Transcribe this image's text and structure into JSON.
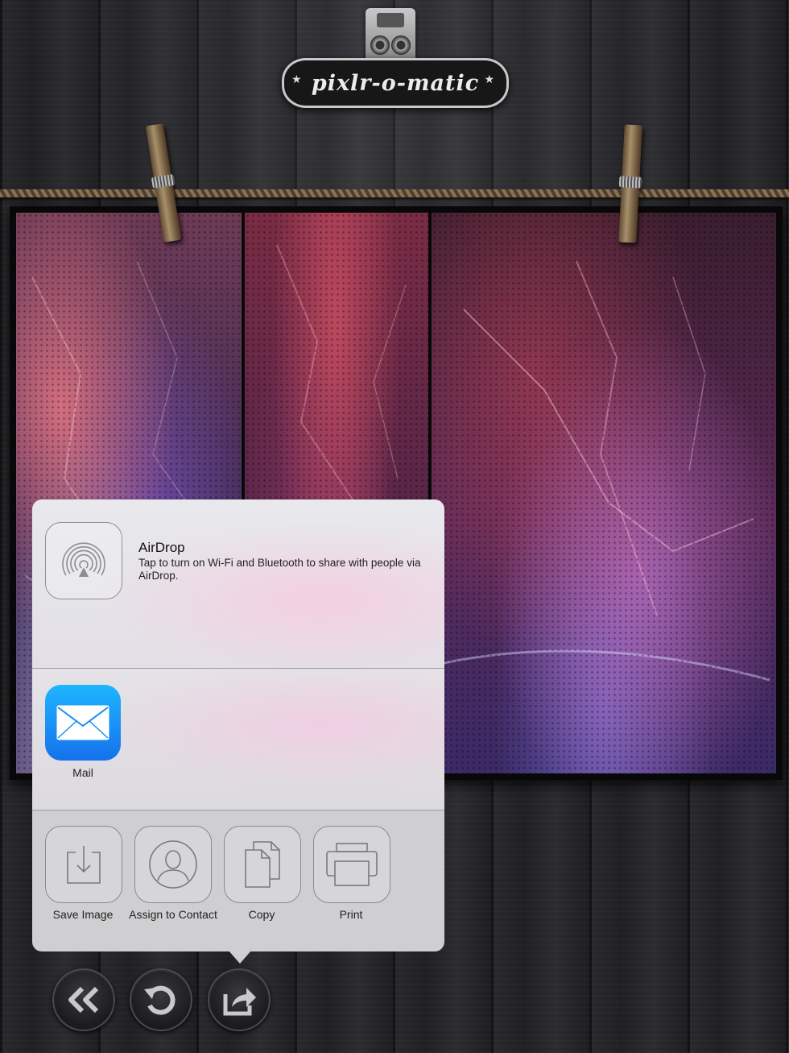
{
  "app": {
    "logo_text": "pixlr-o-matic"
  },
  "share_sheet": {
    "airdrop": {
      "title": "AirDrop",
      "description": "Tap to turn on Wi-Fi and Bluetooth to share with people via AirDrop."
    },
    "apps": [
      {
        "label": "Mail",
        "icon": "mail-icon"
      }
    ],
    "actions": [
      {
        "label": "Save Image",
        "icon": "save-image-icon"
      },
      {
        "label": "Assign to Contact",
        "icon": "contact-icon"
      },
      {
        "label": "Copy",
        "icon": "copy-icon"
      },
      {
        "label": "Print",
        "icon": "print-icon"
      }
    ]
  },
  "toolbar": {
    "buttons": [
      {
        "icon": "back-double-chevron-icon"
      },
      {
        "icon": "refresh-icon"
      },
      {
        "icon": "share-icon"
      }
    ]
  },
  "colors": {
    "mail_gradient_top": "#1fb6ff",
    "mail_gradient_bottom": "#1571ec",
    "background": "#1c1c1f"
  }
}
